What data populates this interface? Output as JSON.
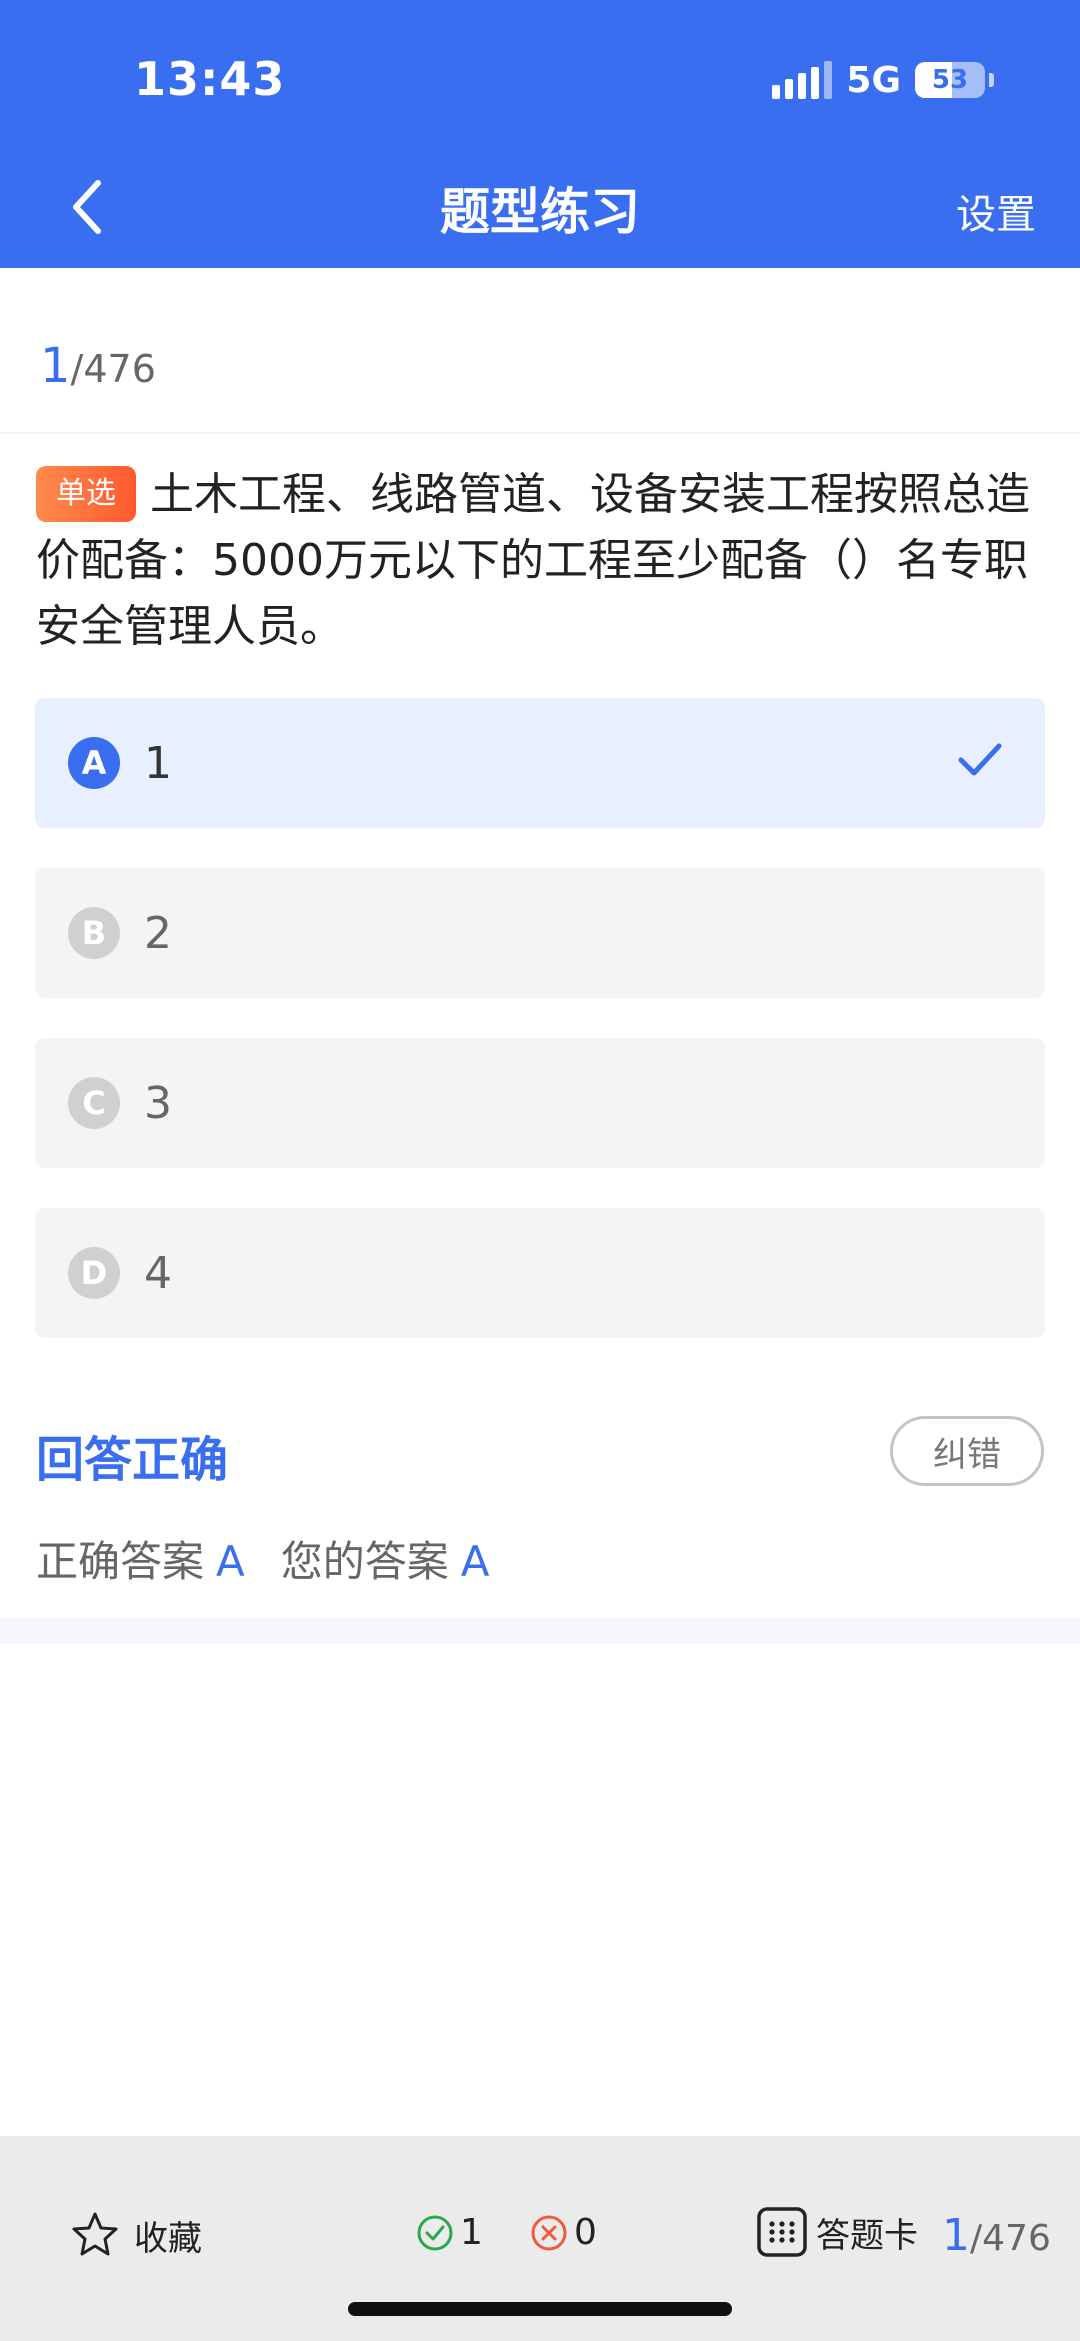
{
  "status_bar": {
    "time": "13:43",
    "network": "5G",
    "battery": "53",
    "battery_level": 0.53
  },
  "nav": {
    "title": "题型练习",
    "settings_label": "设置",
    "back_icon": "chevron-left-icon"
  },
  "progress": {
    "current": "1",
    "total": "/476"
  },
  "question": {
    "type_tag": "单选",
    "text": "土木工程、线路管道、设备安装工程按照总造价配备：5000万元以下的工程至少配备（）名专职安全管理人员。"
  },
  "options": [
    {
      "letter": "A",
      "text": "1",
      "selected": true
    },
    {
      "letter": "B",
      "text": "2",
      "selected": false
    },
    {
      "letter": "C",
      "text": "3",
      "selected": false
    },
    {
      "letter": "D",
      "text": "4",
      "selected": false
    }
  ],
  "result": {
    "status": "回答正确",
    "report_label": "纠错",
    "correct_label": "正确答案",
    "correct_value": "A",
    "yours_label": "您的答案",
    "yours_value": "A"
  },
  "bottom_bar": {
    "favorite_label": "收藏",
    "correct_count": "1",
    "wrong_count": "0",
    "answer_card_label": "答题卡",
    "page_current": "1",
    "page_total": "/476"
  },
  "colors": {
    "primary": "#3a6ef0",
    "tag": "#ff6a3a",
    "correct": "#2ba84a",
    "wrong": "#f05a3a"
  }
}
